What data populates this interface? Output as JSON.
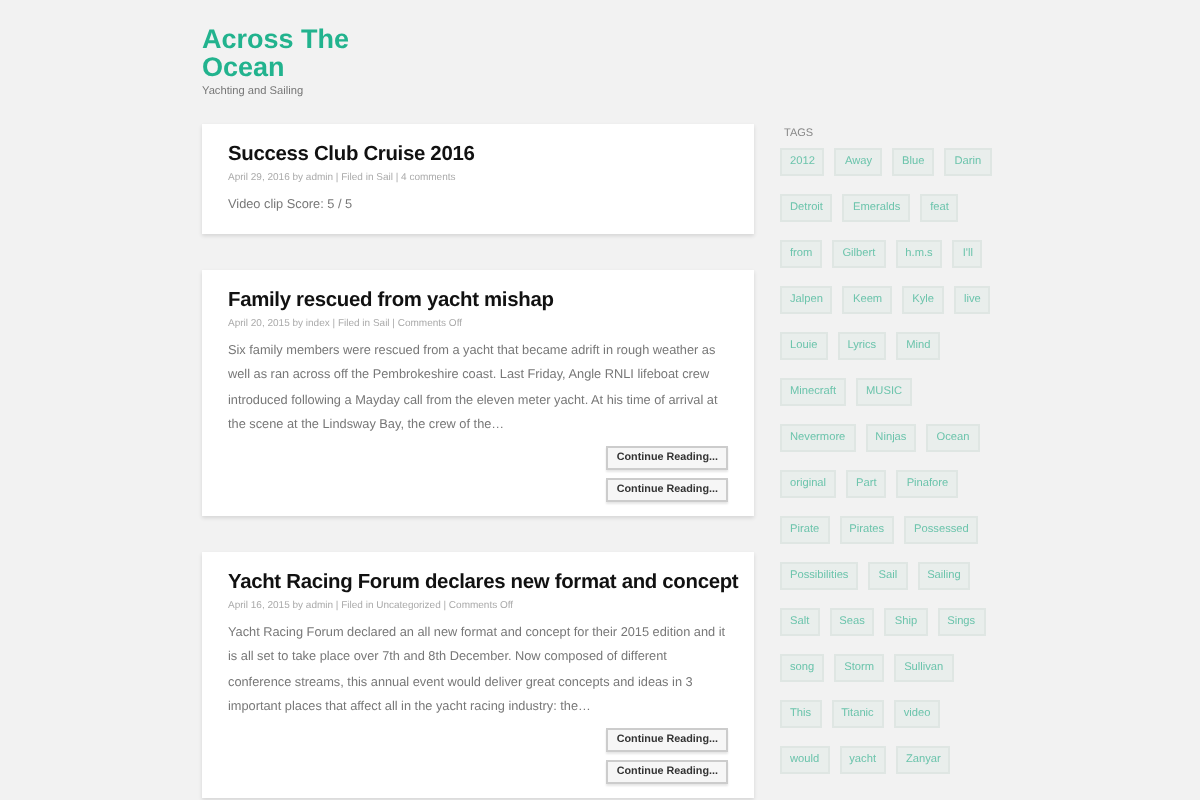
{
  "site": {
    "title": "Across The Ocean",
    "tagline": "Yachting and Sailing"
  },
  "posts": [
    {
      "title": "Success Club Cruise 2016",
      "meta": "April 29, 2016 by admin | Filed in Sail | 4 comments",
      "excerpt": "Video clip Score: 5 / 5"
    },
    {
      "title": "Family rescued from yacht mishap",
      "meta": "April 20, 2015 by index | Filed in Sail | Comments Off",
      "excerpt": "Six family members were rescued from a yacht that became adrift in rough weather as well as ran across off the Pembrokeshire coast. Last Friday, Angle RNLI lifeboat crew introduced following a Mayday call from the eleven meter yacht. At his time of arrival at the scene at the Lindsway Bay, the crew of the…",
      "buttons": [
        "Continue Reading...",
        "Continue Reading..."
      ]
    },
    {
      "title": "Yacht Racing Forum declares new format and concept",
      "meta": "April 16, 2015 by admin | Filed in Uncategorized | Comments Off",
      "excerpt": "Yacht Racing Forum declared an all new format and concept for their 2015 edition and it is all set to take place over 7th and 8th December. Now composed of different conference streams, this annual event would deliver great concepts and ideas in 3 important places that affect all in the yacht racing industry: the…",
      "buttons": [
        "Continue Reading...",
        "Continue Reading..."
      ]
    }
  ],
  "sidebar": {
    "heading": "TAGS",
    "tag_rows": [
      {
        "tags": [
          "2012",
          "Away",
          "Blue",
          "Darin"
        ]
      },
      {
        "tags": [
          "Detroit",
          "Emeralds",
          "feat"
        ]
      },
      {
        "tags": [
          "from",
          "Gilbert",
          "h.m.s",
          "I'll"
        ]
      },
      {
        "tags": [
          "Jalpen",
          "Keem",
          "Kyle",
          "live"
        ]
      },
      {
        "tags": [
          "Louie",
          "Lyrics",
          "Mind"
        ]
      },
      {
        "tags": [
          "Minecraft",
          "MUSIC"
        ]
      },
      {
        "tags": [
          "Nevermore",
          "Ninjas",
          "Ocean"
        ]
      },
      {
        "tags": [
          "original",
          "Part",
          "Pinafore"
        ]
      },
      {
        "tags": [
          "Pirate",
          "Pirates",
          "Possessed"
        ]
      },
      {
        "tags": [
          "Possibilities",
          "Sail",
          "Sailing"
        ]
      },
      {
        "tags": [
          "Salt",
          "Seas",
          "Ship",
          "Sings"
        ]
      },
      {
        "tags": [
          "song",
          "Storm",
          "Sullivan"
        ]
      },
      {
        "tags": [
          "This",
          "Titanic",
          "video"
        ]
      },
      {
        "tags": [
          "would",
          "yacht",
          "Zanyar"
        ]
      }
    ]
  }
}
